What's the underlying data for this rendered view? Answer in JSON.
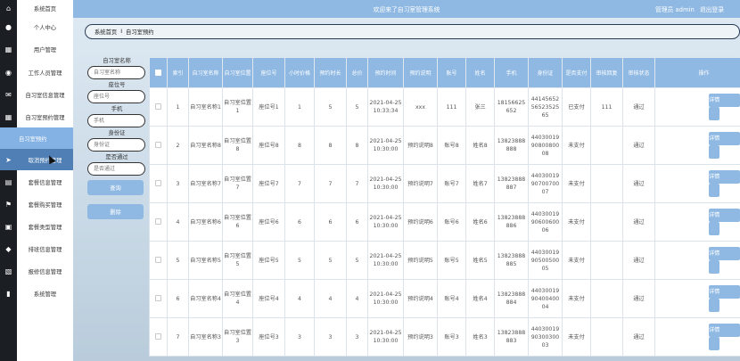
{
  "sidebar": {
    "items": [
      {
        "label": "系统首页",
        "icon": "home-icon"
      },
      {
        "label": "个人中心",
        "icon": "user-icon"
      },
      {
        "label": "用户管理",
        "icon": "grid-icon"
      },
      {
        "label": "工作人员管理",
        "icon": "person-icon"
      },
      {
        "label": "自习室信息管理",
        "icon": "mail-icon"
      },
      {
        "label": "自习室预约管理",
        "icon": "grid-icon"
      },
      {
        "label": "自习室预约",
        "icon": "",
        "active": true
      },
      {
        "label": "取消预约管理",
        "icon": "send-icon"
      },
      {
        "label": "套餐信息管理",
        "icon": "table-icon"
      },
      {
        "label": "套餐购买管理",
        "icon": "flag-icon"
      },
      {
        "label": "套餐类型管理",
        "icon": "printer-icon"
      },
      {
        "label": "排班信息管理",
        "icon": "location-icon"
      },
      {
        "label": "报修信息管理",
        "icon": "layers-icon"
      },
      {
        "label": "系统管理",
        "icon": "chart-icon"
      }
    ]
  },
  "header": {
    "title": "欢迎来了自习室管理系统",
    "user_label": "管理员 admin",
    "logout_label": "退出登录"
  },
  "breadcrumb": {
    "home": "系统首页",
    "separator": "I",
    "current": "自习室预约"
  },
  "search": {
    "fields": [
      {
        "label": "自习室名称",
        "placeholder": "自习室名称"
      },
      {
        "label": "座位号",
        "placeholder": "座位号"
      },
      {
        "label": "手机",
        "placeholder": "手机"
      },
      {
        "label": "身份证",
        "placeholder": "身份证"
      },
      {
        "label": "是否通过",
        "placeholder": "是否通过"
      }
    ],
    "query_label": "查询",
    "delete_label": "删除"
  },
  "table": {
    "headers": [
      "",
      "索引",
      "自习室名称",
      "自习室位置",
      "座位号",
      "小时价格",
      "预约时长",
      "总价",
      "预约时间",
      "预约说明",
      "账号",
      "姓名",
      "手机",
      "身份证",
      "是否支付",
      "审核回复",
      "审核状态",
      "操作"
    ],
    "detail_label": "详情",
    "rows": [
      [
        "",
        "1",
        "自习室名称1",
        "自习室位置1",
        "座位号1",
        "1",
        "5",
        "5",
        "2021-04-25 10:33:34",
        "xxx",
        "111",
        "张三",
        "18156625652",
        "441456525652352565",
        "已支付",
        "111",
        "通过"
      ],
      [
        "",
        "2",
        "自习室名称8",
        "自习室位置8",
        "座位号8",
        "8",
        "8",
        "8",
        "2021-04-25 10:30:00",
        "预约说明8",
        "账号8",
        "姓名8",
        "13823888888",
        "440300199080080008",
        "未支付",
        "",
        "通过"
      ],
      [
        "",
        "3",
        "自习室名称7",
        "自习室位置7",
        "座位号7",
        "7",
        "7",
        "7",
        "2021-04-25 10:30:00",
        "预约说明7",
        "账号7",
        "姓名7",
        "13823888887",
        "440300199070070007",
        "未支付",
        "",
        "通过"
      ],
      [
        "",
        "4",
        "自习室名称6",
        "自习室位置6",
        "座位号6",
        "6",
        "6",
        "6",
        "2021-04-25 10:30:00",
        "预约说明6",
        "账号6",
        "姓名6",
        "13823888886",
        "440300199060060006",
        "未支付",
        "",
        "通过"
      ],
      [
        "",
        "5",
        "自习室名称5",
        "自习室位置5",
        "座位号5",
        "5",
        "5",
        "5",
        "2021-04-25 10:30:00",
        "预约说明5",
        "账号5",
        "姓名5",
        "13823888885",
        "440300199050050005",
        "未支付",
        "",
        "通过"
      ],
      [
        "",
        "6",
        "自习室名称4",
        "自习室位置4",
        "座位号4",
        "4",
        "4",
        "4",
        "2021-04-25 10:30:00",
        "预约说明4",
        "账号4",
        "姓名4",
        "13823888884",
        "440300199040040004",
        "未支付",
        "",
        "通过"
      ],
      [
        "",
        "7",
        "自习室名称3",
        "自习室位置3",
        "座位号3",
        "3",
        "3",
        "3",
        "2021-04-25 10:30:00",
        "预约说明3",
        "账号3",
        "姓名3",
        "13823888883",
        "440300199030030003",
        "未支付",
        "",
        "通过"
      ]
    ]
  },
  "colors": {
    "accent": "#8fb9e3",
    "sidebar_strip": "#1b1f24"
  }
}
